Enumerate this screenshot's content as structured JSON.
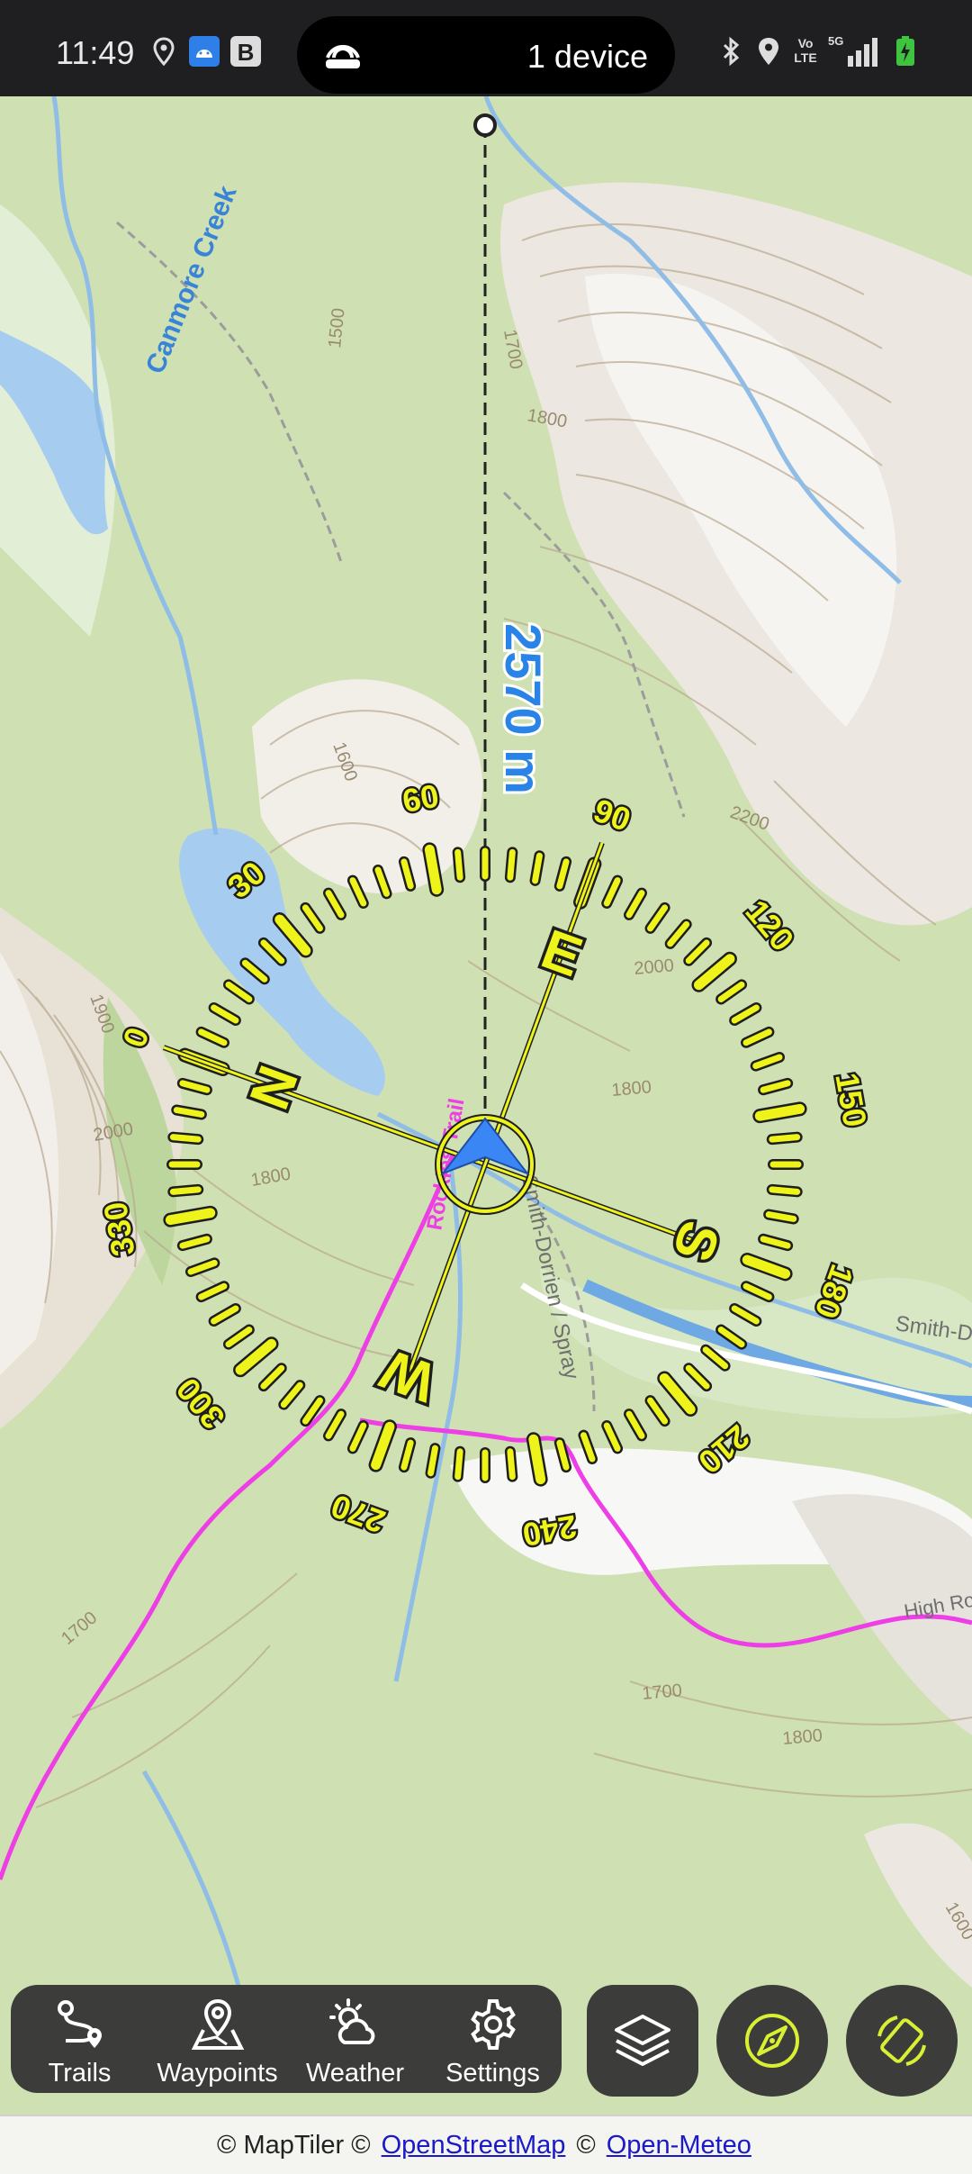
{
  "status_bar": {
    "time": "11:49",
    "pill_text": "1 device",
    "icons": [
      "location-icon",
      "android-icon",
      "b-icon",
      "hotspot-icon",
      "bluetooth-icon",
      "location-pin-icon",
      "volte-icon",
      "signal-5g-icon",
      "battery-charging-icon"
    ],
    "volte_label": "Vo LTE",
    "network_label": "5G"
  },
  "map": {
    "distance_label": "2570 m",
    "labels": {
      "creek": "Canmore Creek",
      "trail": "Rockies Trail",
      "road1": "Smith-Dorrien / Spray",
      "road2": "Smith-Dorrien",
      "road3": "Smith-Do",
      "high_rockies": "High Ro",
      "c1500": "1500",
      "c1700a": "1700",
      "c1800a": "1800",
      "c1600": "1600",
      "c2200": "2200",
      "c2000a": "2000",
      "c1800b": "1800",
      "c1900": "1900",
      "c2000b": "2000",
      "c1800c": "1800",
      "c1700b": "1700",
      "c1700c": "1700",
      "c1800d": "1800",
      "c1600b": "1600"
    },
    "compass": {
      "cardinals": [
        "N",
        "E",
        "S",
        "W"
      ],
      "degrees": [
        "0",
        "30",
        "60",
        "90",
        "120",
        "150",
        "180",
        "210",
        "240",
        "270",
        "300",
        "330"
      ],
      "ring_color": "#eef41a",
      "heading_color": "#3a86f5"
    }
  },
  "nav": {
    "items": [
      {
        "label": "Trails",
        "icon": "trails-icon"
      },
      {
        "label": "Waypoints",
        "icon": "waypoints-icon"
      },
      {
        "label": "Weather",
        "icon": "weather-icon"
      },
      {
        "label": "Settings",
        "icon": "gear-icon"
      }
    ],
    "layers_icon": "layers-icon",
    "compass_icon": "compass-icon",
    "rotate_icon": "rotate-map-icon"
  },
  "attribution": {
    "maptiler": "© MapTiler ©",
    "osm": "OpenStreetMap",
    "sep": "©",
    "openmeteo": "Open-Meteo"
  }
}
